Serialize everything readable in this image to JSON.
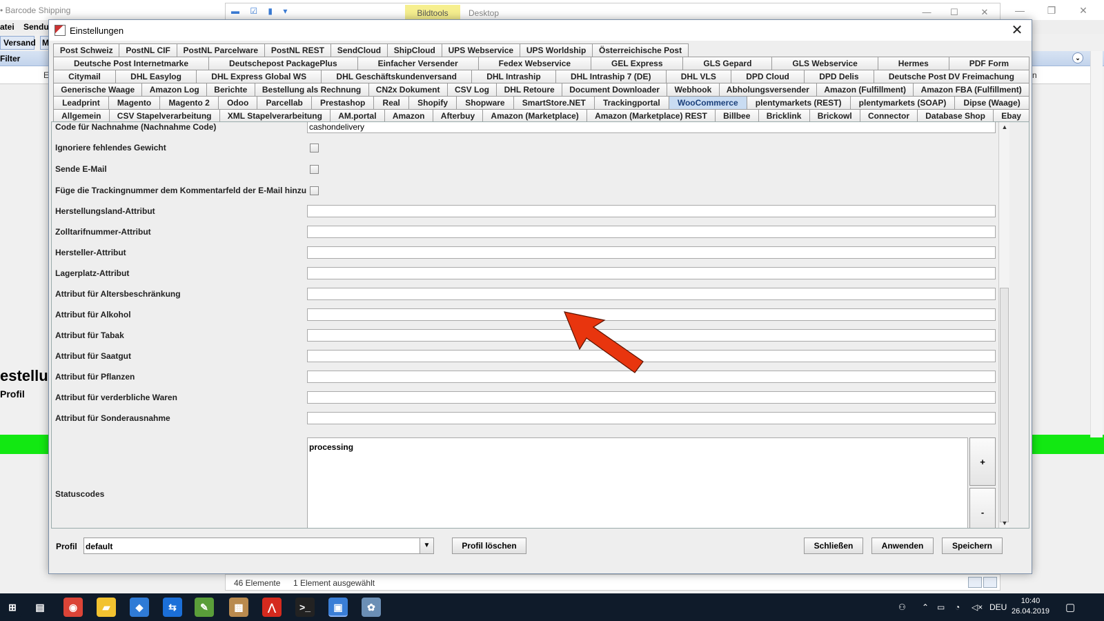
{
  "background_app": {
    "title": "• Barcode Shipping",
    "menu": [
      "atei",
      "Sendu"
    ],
    "tab": "Versand",
    "tab2": "M",
    "filter_label": "Filter",
    "big_title": "estellu",
    "profile_label": "Profil",
    "sidebar_char": "E",
    "right_char": "n"
  },
  "explorer": {
    "bildtools": "Bildtools",
    "desktop": "Desktop"
  },
  "status_bar": {
    "count": "46 Elemente",
    "selected": "1 Element ausgewählt"
  },
  "dialog": {
    "title": "Einstellungen",
    "close": "✕",
    "tab_rows": [
      [
        "Post Schweiz",
        "PostNL CIF",
        "PostNL Parcelware",
        "PostNL REST",
        "SendCloud",
        "ShipCloud",
        "UPS Webservice",
        "UPS Worldship",
        "Österreichische Post"
      ],
      [
        "Deutsche Post Internetmarke",
        "Deutschepost PackagePlus",
        "Einfacher Versender",
        "Fedex Webservice",
        "GEL Express",
        "GLS Gepard",
        "GLS Webservice",
        "Hermes",
        "PDF Form"
      ],
      [
        "Citymail",
        "DHL Easylog",
        "DHL Express Global WS",
        "DHL Geschäftskundenversand",
        "DHL Intraship",
        "DHL Intraship 7 (DE)",
        "DHL VLS",
        "DPD Cloud",
        "DPD Delis",
        "Deutsche Post DV Freimachung"
      ],
      [
        "Generische Waage",
        "Amazon Log",
        "Berichte",
        "Bestellung als Rechnung",
        "CN2x Dokument",
        "CSV Log",
        "DHL Retoure",
        "Document Downloader",
        "Webhook",
        "Abholungsversender",
        "Amazon (Fulfillment)",
        "Amazon FBA (Fulfillment)"
      ],
      [
        "Leadprint",
        "Magento",
        "Magento 2",
        "Odoo",
        "Parcellab",
        "Prestashop",
        "Real",
        "Shopify",
        "Shopware",
        "SmartStore.NET",
        "Trackingportal",
        "WooCommerce",
        "plentymarkets (REST)",
        "plentymarkets (SOAP)",
        "Dipse (Waage)"
      ],
      [
        "Allgemein",
        "CSV Stapelverarbeitung",
        "XML Stapelverarbeitung",
        "AM.portal",
        "Amazon",
        "Afterbuy",
        "Amazon (Marketplace)",
        "Amazon (Marketplace) REST",
        "Billbee",
        "Bricklink",
        "Brickowl",
        "Connector",
        "Database Shop",
        "Ebay"
      ]
    ],
    "selected_tab": "WooCommerce",
    "fields": {
      "nachnahme_label": "Code für Nachnahme (Nachnahme Code)",
      "nachnahme_value": "cashondelivery",
      "ignore_weight_label": "Ignoriere fehlendes Gewicht",
      "send_email_label": "Sende E-Mail",
      "tracking_comment_label": "Füge die Trackingnummer dem Kommentarfeld der E-Mail hinzu",
      "herstellungsland_label": "Herstellungsland-Attribut",
      "zolltarif_label": "Zolltarifnummer-Attribut",
      "hersteller_label": "Hersteller-Attribut",
      "lagerplatz_label": "Lagerplatz-Attribut",
      "alter_label": "Attribut für Altersbeschränkung",
      "alkohol_label": "Attribut für Alkohol",
      "tabak_label": "Attribut für Tabak",
      "saatgut_label": "Attribut für Saatgut",
      "pflanzen_label": "Attribut für Pflanzen",
      "verderblich_label": "Attribut für verderbliche Waren",
      "sonderausnahme_label": "Attribut für Sonderausnahme",
      "statuscodes_label": "Statuscodes",
      "statuscodes_value": "processing",
      "add_label": "+",
      "remove_label": "-"
    },
    "bottom": {
      "profile_label": "Profil",
      "profile_value": "default",
      "delete_profile": "Profil löschen",
      "close_btn": "Schließen",
      "apply_btn": "Anwenden",
      "save_btn": "Speichern"
    }
  },
  "annotation": {
    "arrow_color": "#e8350e",
    "icon": "red-arrow-icon"
  },
  "taskbar": {
    "lang": "DEU",
    "time": "10:40",
    "date": "26.04.2019",
    "icons": [
      "windows-start-icon",
      "task-view-icon",
      "chrome-icon",
      "file-explorer-icon",
      "vscode-icon",
      "teamviewer-icon",
      "notepad-icon",
      "package-icon",
      "acrobat-icon",
      "terminal-icon",
      "remote-desktop-icon",
      "paint-icon"
    ]
  }
}
